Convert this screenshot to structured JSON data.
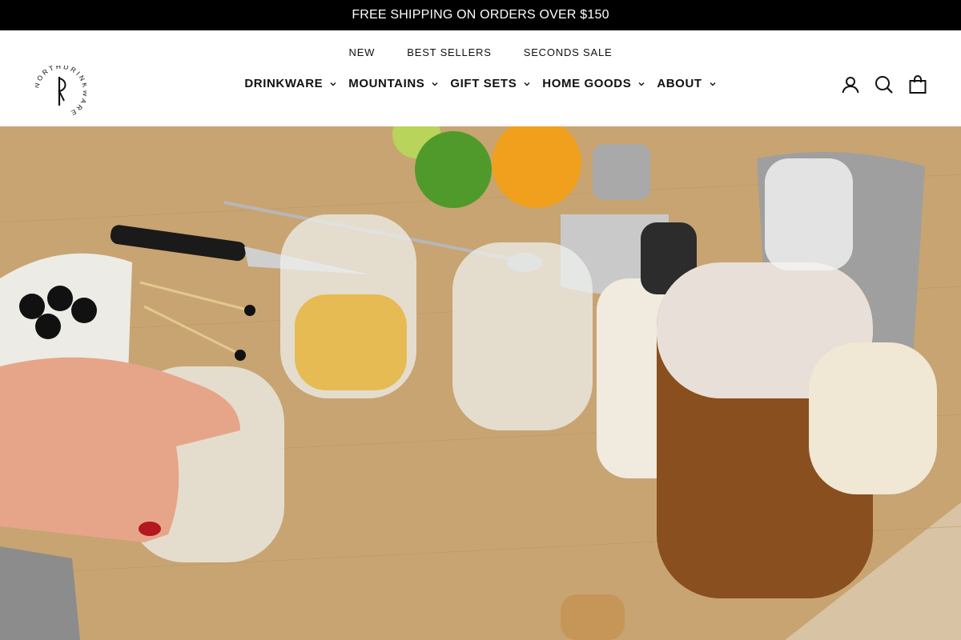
{
  "announcement": {
    "text": "FREE SHIPPING ON ORDERS OVER $150"
  },
  "brand": {
    "logo_text": "NORTHDRINKWARE"
  },
  "top_links": [
    {
      "label": "NEW"
    },
    {
      "label": "BEST SELLERS"
    },
    {
      "label": "SECONDS SALE"
    }
  ],
  "main_nav": [
    {
      "label": "DRINKWARE"
    },
    {
      "label": "MOUNTAINS"
    },
    {
      "label": "GIFT SETS"
    },
    {
      "label": "HOME GOODS"
    },
    {
      "label": "ABOUT"
    }
  ],
  "icons": {
    "account": "user-icon",
    "search": "search-icon",
    "cart": "cart-bag-icon"
  },
  "colors": {
    "announcement_bg": "#000000",
    "announcement_text": "#ffffff",
    "header_bg": "#ffffff",
    "text": "#111111"
  }
}
